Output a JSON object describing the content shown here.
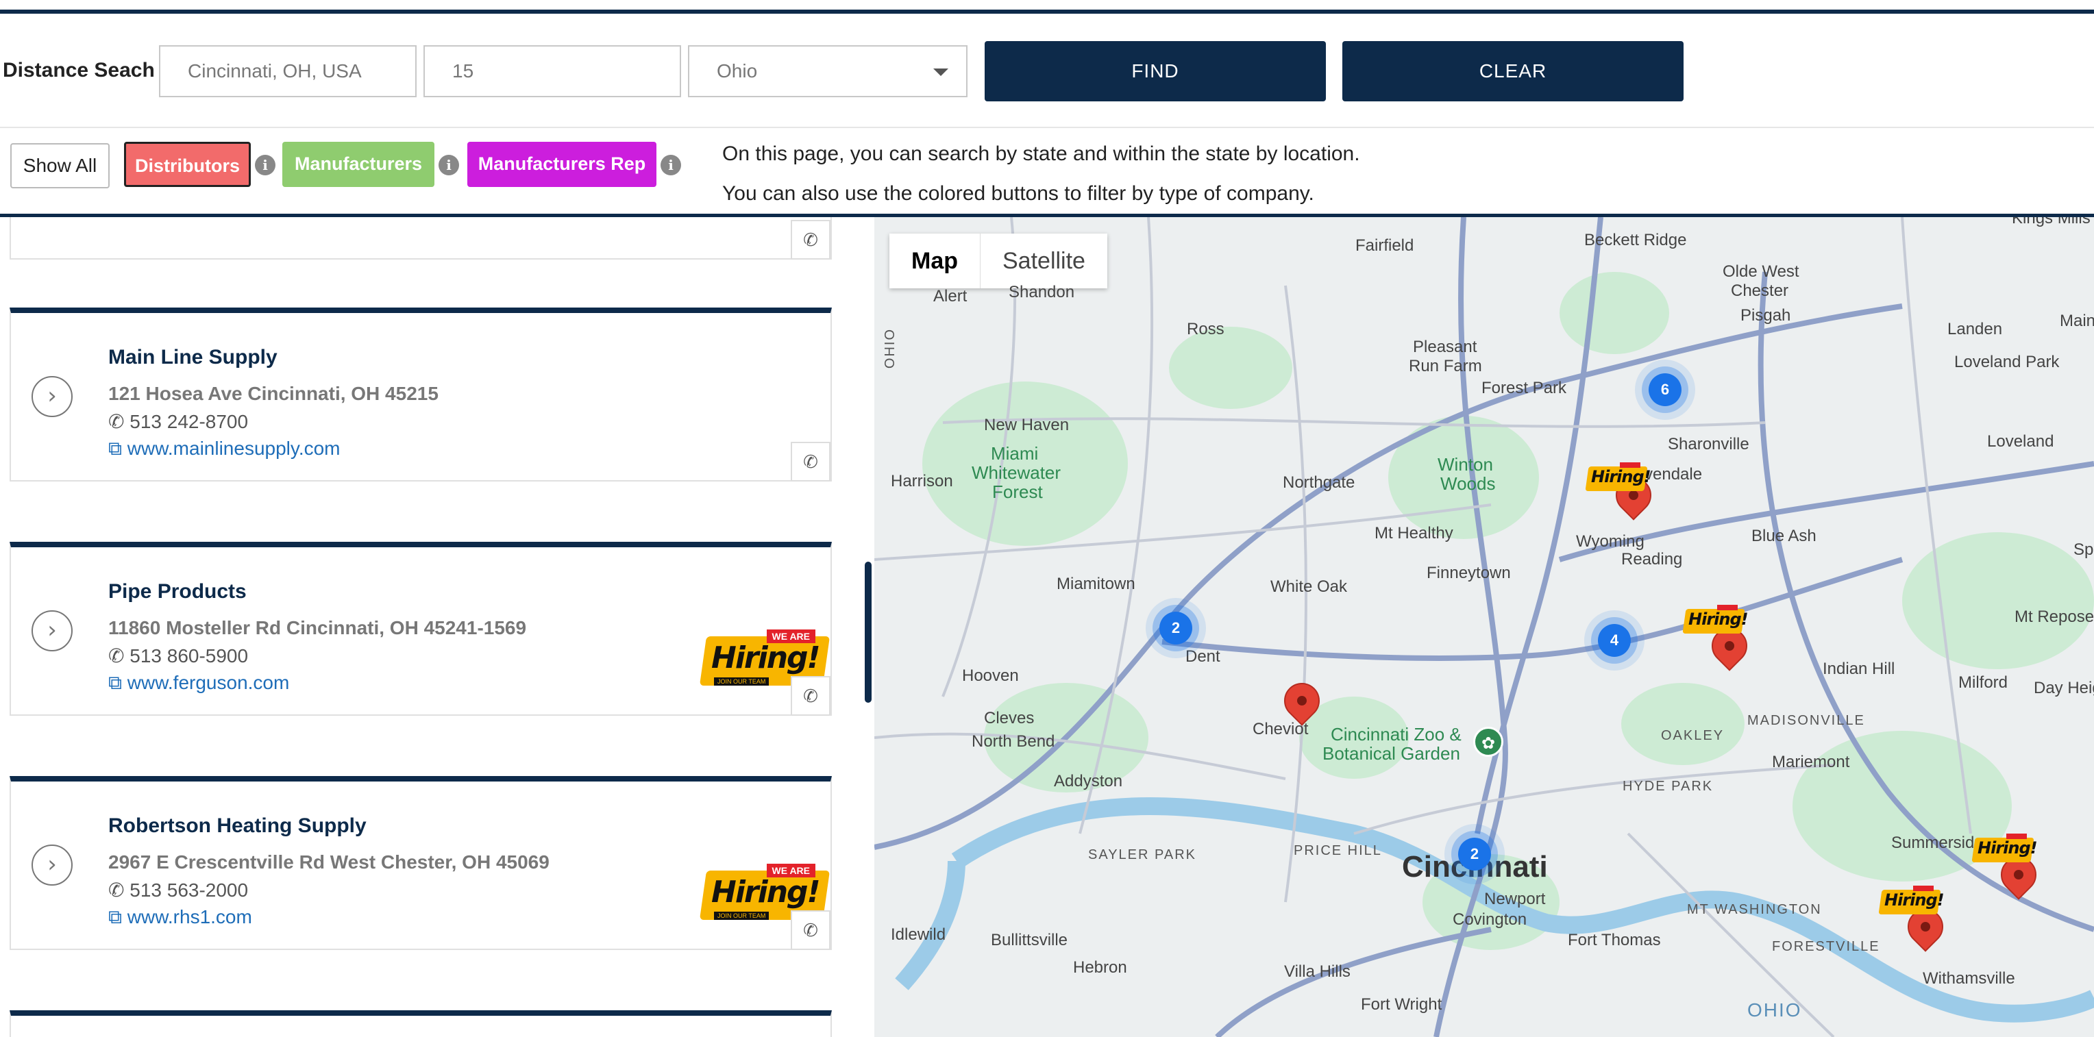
{
  "search": {
    "label": "Distance Seach",
    "city_value": "Cincinnati, OH, USA",
    "distance_value": "15",
    "state_value": "Ohio",
    "find_label": "FIND",
    "clear_label": "CLEAR"
  },
  "filters": {
    "show_all": "Show All",
    "distributors": "Distributors",
    "manufacturers": "Manufacturers",
    "manufacturers_rep": "Manufacturers Rep",
    "info_glyph": "i",
    "help_line1": "On this page, you can search by state and within the state by location.",
    "help_line2": "You can also use the colored buttons to filter by type of company.",
    "colors": {
      "distributors": "#f26b6b",
      "manufacturers": "#8fcc6f",
      "manufacturers_rep": "#cc1edd"
    }
  },
  "listings": [
    {
      "name": "Main Line Supply",
      "address": "121 Hosea Ave Cincinnati, OH 45215",
      "phone": "513 242-8700",
      "website": "www.mainlinesupply.com",
      "hiring": false
    },
    {
      "name": "Pipe Products",
      "address": "11860 Mosteller Rd Cincinnati, OH 45241-1569",
      "phone": "513 860-5900",
      "website": "www.ferguson.com",
      "hiring": true
    },
    {
      "name": "Robertson Heating Supply",
      "address": "2967 E Crescentville Rd West Chester, OH 45069",
      "phone": "513 563-2000",
      "website": "www.rhs1.com",
      "hiring": true
    }
  ],
  "hiring_badge": {
    "top": "WE ARE",
    "main": "Hiring!",
    "sub": "JOIN OUR TEAM"
  },
  "map": {
    "type_map": "Map",
    "type_satellite": "Satellite",
    "clusters": [
      "6",
      "2",
      "4",
      "2"
    ],
    "places": {
      "fairfield": "Fairfield",
      "beckett": "Beckett Ridge",
      "olde": "Olde West",
      "chester": "Chester",
      "pisgah": "Pisgah",
      "landen": "Landen",
      "maineville": "Maineville",
      "loveland_park": "Loveland Park",
      "alert": "Alert",
      "shandon": "Shandon",
      "ross": "Ross",
      "pleasant": "Pleasant",
      "run_farm": "Run Farm",
      "forest_park": "Forest Park",
      "new_haven": "New Haven",
      "sharonville": "Sharonville",
      "loveland": "Loveland",
      "miami1": "Miami",
      "miami2": "Whitewater",
      "miami3": "Forest",
      "harrison": "Harrison",
      "northgate": "Northgate",
      "winton1": "Winton",
      "winton2": "Woods",
      "evendale": "vendale",
      "mt_healthy": "Mt Healthy",
      "wyoming": "Wyoming",
      "reading": "Reading",
      "blue_ash": "Blue Ash",
      "miamitown": "Miamitown",
      "white_oak": "White Oak",
      "finneytown": "Finneytown",
      "mt_repose": "Mt Repose",
      "dent": "Dent",
      "indian_hill": "Indian Hill",
      "hooven": "Hooven",
      "milford": "Milford",
      "day_heights": "Day Heights",
      "cleves": "Cleves",
      "north_bend": "North Bend",
      "cheviot": "Cheviot",
      "zoo1": "Cincinnati Zoo &",
      "zoo2": "Botanical Garden",
      "oakley": "OAKLEY",
      "madisonville": "MADISONVILLE",
      "addyston": "Addyston",
      "mariemont": "Mariemont",
      "hyde_park": "HYDE PARK",
      "sayler_park": "SAYLER PARK",
      "price_hill": "PRICE HILL",
      "cincinnati": "Cincinnati",
      "summerside": "Summerside",
      "newport": "Newport",
      "covington": "Covington",
      "mt_washington": "MT WASHINGTON",
      "idlewild": "Idlewild",
      "bullittsville": "Bullittsville",
      "fort_thomas": "Fort Thomas",
      "forestville": "FORESTVILLE",
      "hebron": "Hebron",
      "villa_hills": "Villa Hills",
      "withamsville": "Withamsville",
      "fort_wright": "Fort Wright",
      "ohio_river": "OHIO",
      "kings_mills": "Kings Mills",
      "ohio_state": "OHIO",
      "sp": "Sp"
    },
    "pin_hiring": "Hiring!"
  }
}
